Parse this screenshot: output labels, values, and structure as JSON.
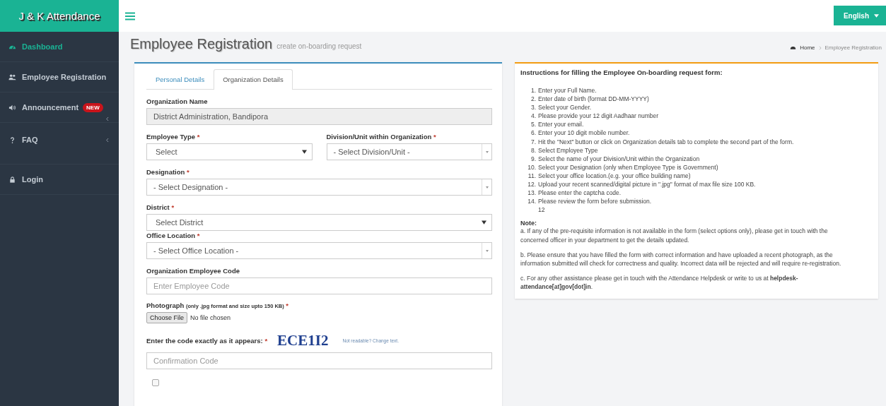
{
  "brand": "J & K Attendance",
  "language_button": "English",
  "sidebar": {
    "items": [
      {
        "label": "Dashboard",
        "selected": true
      },
      {
        "label": "Employee Registration",
        "selected": false
      },
      {
        "label": "Announcement",
        "selected": false,
        "badge": "NEW",
        "expandable": true
      },
      {
        "label": "FAQ",
        "selected": false,
        "expandable": true
      },
      {
        "label": "Login",
        "selected": false
      }
    ]
  },
  "page": {
    "title": "Employee Registration",
    "subtitle": "create on-boarding request"
  },
  "breadcrumb": [
    "Home",
    "Employee Registration"
  ],
  "tabs": [
    {
      "label": "Personal Details",
      "selected": false
    },
    {
      "label": "Organization Details",
      "selected": true
    }
  ],
  "form": {
    "rows": [
      [
        {
          "kind": "text",
          "label": "Organization Name",
          "value": "District Administration, Bandipora",
          "disabled": true
        }
      ],
      [
        {
          "kind": "select",
          "label": "Employee Type",
          "required_mark": "*",
          "value": "Select"
        },
        {
          "kind": "select2",
          "label": "Division/Unit within Organization",
          "required_mark": "*",
          "value": "- Select Division/Unit -"
        }
      ],
      [
        {
          "kind": "select2",
          "label": "Designation",
          "required_mark": "*",
          "value": "- Select Designation -"
        }
      ],
      [
        {
          "kind": "select",
          "label": "District",
          "required_mark": "*",
          "value": "Select District"
        }
      ],
      [
        {
          "kind": "select2",
          "label": "Office Location",
          "required_mark": "*",
          "value": "- Select Office Location -"
        }
      ],
      [
        {
          "kind": "text",
          "label": "Organization Employee Code",
          "placeholder": "Enter Employee Code",
          "disabled": false
        }
      ],
      [
        {
          "kind": "file",
          "label": "Photograph",
          "note": "(only .jpg format and size upto 150 KB)",
          "required_mark": "*",
          "button": "Choose File",
          "status": "No file chosen"
        }
      ],
      [
        {
          "kind": "captcha",
          "label": "Enter the code exactly as it appears:",
          "required_mark": "*",
          "code": "ECE1I2",
          "link": "Not readable? Change text.",
          "placeholder": "Confirmation Code"
        }
      ],
      [
        {
          "kind": "checkbox",
          "checked": false
        }
      ]
    ]
  },
  "instructions": {
    "title": "Instructions for filling the Employee On-boarding request form:",
    "steps": [
      {
        "num": "1.",
        "text": "Enter your Full Name."
      },
      {
        "num": "2.",
        "text": "Enter date of birth (format DD-MM-YYYY)"
      },
      {
        "num": "3.",
        "text": "Select your Gender."
      },
      {
        "num": "4.",
        "text": "Please provide your 12 digit Aadhaar number"
      },
      {
        "num": "5.",
        "text": "Enter your email."
      },
      {
        "num": "6.",
        "text": "Enter your 10 digit mobile number."
      },
      {
        "num": "7.",
        "text": "Hit the \"Next\" button or click on Organization details tab to complete the second part of the form."
      },
      {
        "num": "8.",
        "text": "Select Employee Type"
      },
      {
        "num": "9.",
        "text": "Select the name of your Division/Unit within the Organization"
      },
      {
        "num": "10.",
        "text": "Select your Designation (only when Employee Type is Government)"
      },
      {
        "num": "11.",
        "text": "Select your office location.(e.g. your office building name)"
      },
      {
        "num": "12.",
        "text": "Upload your recent scanned/digital picture in \".jpg\" format of max file size 100 KB."
      },
      {
        "num": "13.",
        "text": "Please enter the captcha code."
      },
      {
        "num": "14.",
        "text": "Please review the form before submission."
      }
    ],
    "stray": "12",
    "note_title": "Note:",
    "notes": [
      "a. If any of the pre-requisite information is not available in the form (select options only), please get in touch with the concerned officer in your department to get the details updated.",
      "b. Please ensure that you have filled the form with correct information and have uploaded a recent photograph, as the information submitted will check for correctness and quality. Incorrect data will be rejected and will require re-registration.",
      "c. For any other assistance please get in touch with the Attendance Helpdesk or write to us at **helpdesk-attendance[at]gov[dot]in**."
    ]
  }
}
